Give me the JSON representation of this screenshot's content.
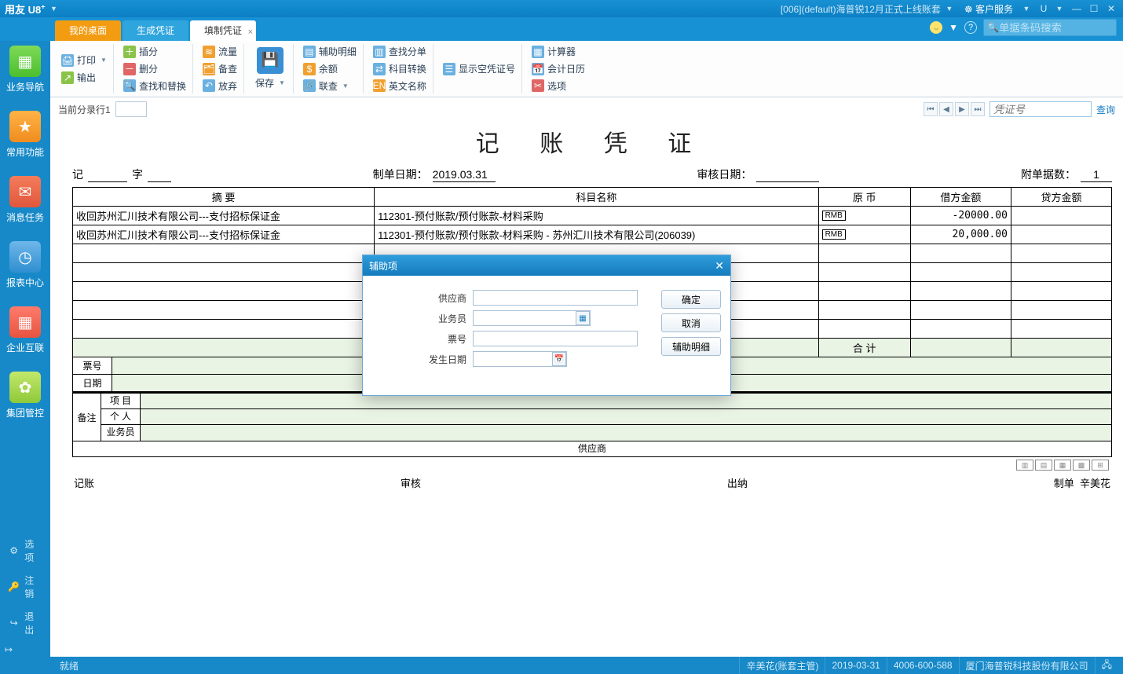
{
  "title_bar": {
    "brand": "用友 U8",
    "brand_sup": "+",
    "account": "[006](default)海普锐12月正式上线账套",
    "service": "客户服务",
    "u_label": "U"
  },
  "tabs": {
    "my_desktop": "我的桌面",
    "gen_voucher": "生成凭证",
    "fill_voucher": "填制凭证"
  },
  "top_search_placeholder": "单据条码搜索",
  "sidebar": {
    "items": [
      {
        "label": "业务导航"
      },
      {
        "label": "常用功能"
      },
      {
        "label": "消息任务"
      },
      {
        "label": "报表中心"
      },
      {
        "label": "企业互联"
      },
      {
        "label": "集团管控"
      }
    ],
    "bottom": {
      "options": "选项",
      "logout": "注销",
      "exit": "退出"
    }
  },
  "ribbon": {
    "print": "打印",
    "output": "输出",
    "insert_row": "插分",
    "delete_row": "删分",
    "find_replace": "查找和替换",
    "flow": "流量",
    "memo": "备查",
    "abandon": "放弃",
    "save": "保存",
    "aux_detail": "辅助明细",
    "balance": "余额",
    "linkq": "联查",
    "find_split": "查找分单",
    "subj_convert": "科目转换",
    "eng_name": "英文名称",
    "show_empty": "显示空凭证号",
    "calculator": "计算器",
    "acc_calendar": "会计日历",
    "option": "选项"
  },
  "subbar": {
    "current_row": "当前分录行1",
    "voucher_no_placeholder": "凭证号",
    "query": "查询"
  },
  "voucher": {
    "title": "记 账 凭 证",
    "prefix_ji": "记",
    "prefix_zi": "字",
    "make_date_label": "制单日期：",
    "make_date": "2019.03.31",
    "audit_date_label": "审核日期：",
    "audit_date": "",
    "attach_label": "附单据数：",
    "attach": "1",
    "headers": {
      "summary": "摘 要",
      "subject": "科目名称",
      "currency": "原  币",
      "debit": "借方金额",
      "credit": "贷方金额"
    },
    "rows": [
      {
        "summary": "收回苏州汇川技术有限公司---支付招标保证金",
        "subject": "112301-预付账款/预付账款-材料采购",
        "cur": "RMB",
        "debit": "-20000.00",
        "credit": ""
      },
      {
        "summary": "收回苏州汇川技术有限公司---支付招标保证金",
        "subject": "112301-预付账款/预付账款-材料采购 - 苏州汇川技术有限公司(206039)",
        "cur": "RMB",
        "debit": "20,000.00",
        "credit": ""
      }
    ],
    "total_label": "合  计",
    "bill_no_label": "票号",
    "date_label": "日期",
    "note_label": "备注",
    "note_rows": {
      "project": "项  目",
      "person": "个  人",
      "salesman": "业务员"
    },
    "supplier_label": "供应商",
    "sign": {
      "post": "记账",
      "audit": "审核",
      "cashier": "出纳",
      "maker": "制单",
      "maker_name": "辛美花"
    }
  },
  "modal": {
    "title": "辅助项",
    "labels": {
      "supplier": "供应商",
      "salesman": "业务员",
      "billno": "票号",
      "occur_date": "发生日期"
    },
    "buttons": {
      "ok": "确定",
      "cancel": "取消",
      "aux": "辅助明细"
    }
  },
  "status": {
    "ready": "就绪",
    "user": "辛美花(账套主管)",
    "date": "2019-03-31",
    "hotline": "4006-600-588",
    "company": "厦门海普锐科技股份有限公司"
  }
}
